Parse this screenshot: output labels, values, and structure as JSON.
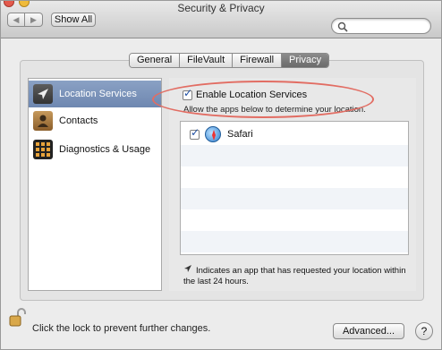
{
  "window": {
    "title": "Security & Privacy"
  },
  "toolbar": {
    "back_icon": "◀",
    "forward_icon": "▶",
    "show_all_label": "Show All"
  },
  "search": {
    "placeholder": ""
  },
  "tabs": [
    {
      "label": "General",
      "active": false
    },
    {
      "label": "FileVault",
      "active": false
    },
    {
      "label": "Firewall",
      "active": false
    },
    {
      "label": "Privacy",
      "active": true
    }
  ],
  "sidebar": {
    "items": [
      {
        "label": "Location Services",
        "selected": true,
        "icon": "location-arrow-icon"
      },
      {
        "label": "Contacts",
        "selected": false,
        "icon": "contacts-book-icon"
      },
      {
        "label": "Diagnostics & Usage",
        "selected": false,
        "icon": "diagnostics-grid-icon"
      }
    ]
  },
  "location": {
    "enable_label": "Enable Location Services",
    "enable_checked": true,
    "enable_description": "Allow the apps below to determine your location.",
    "apps": [
      {
        "name": "Safari",
        "checked": true,
        "icon": "safari-compass-icon"
      }
    ],
    "legend_text": "Indicates an app that has requested your location within the last 24 hours."
  },
  "footer": {
    "lock_text": "Click the lock to prevent further changes.",
    "advanced_label": "Advanced...",
    "help_label": "?"
  },
  "colors": {
    "annotation_ellipse": "#e26d63",
    "selection": "#7a91b8"
  }
}
